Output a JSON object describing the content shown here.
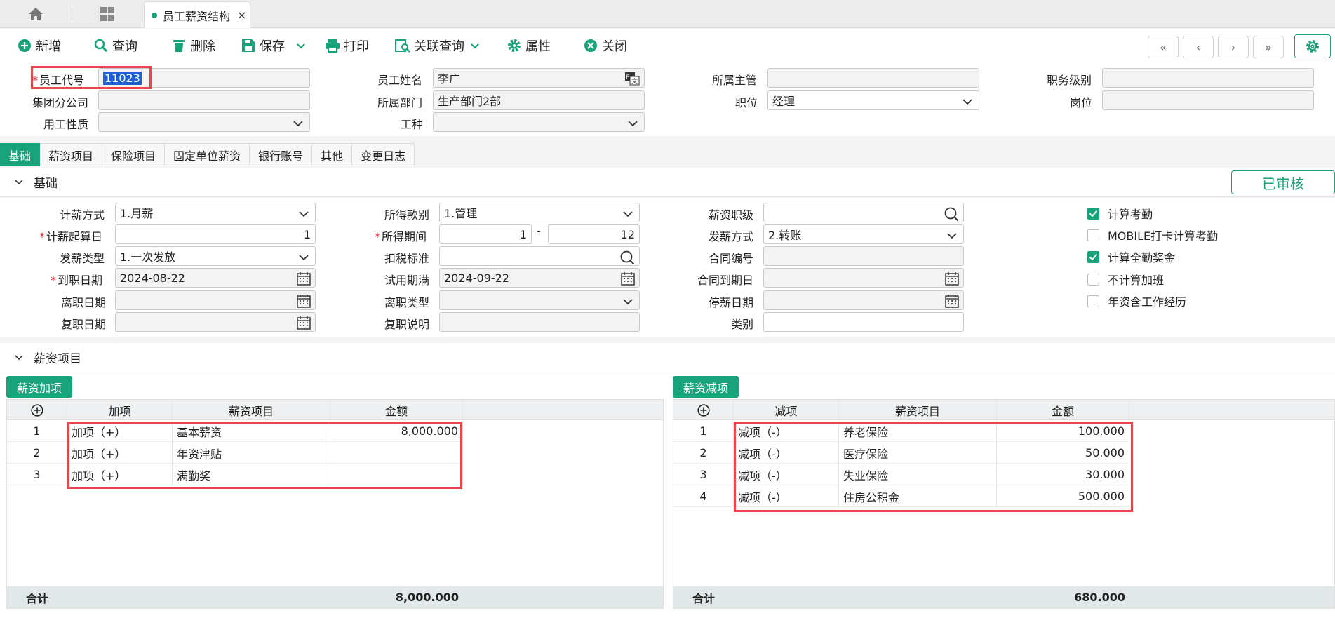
{
  "tabbar": {
    "active_tab": "员工薪资结构",
    "close_glyph": "×"
  },
  "toolbar": {
    "new": "新增",
    "query": "查询",
    "delete": "删除",
    "save": "保存",
    "print": "打印",
    "linked_query": "关联查询",
    "properties": "属性",
    "close": "关闭"
  },
  "header": {
    "employee_code_label": "员工代号",
    "employee_code": "11023",
    "employee_name_label": "员工姓名",
    "employee_name": "李广",
    "supervisor_label": "所属主管",
    "supervisor": "",
    "job_level_label": "职务级别",
    "job_level": "",
    "branch_label": "集团分公司",
    "branch": "",
    "department_label": "所属部门",
    "department": "生产部门2部",
    "position_label": "职位",
    "position": "经理",
    "post_label": "岗位",
    "post": "",
    "employment_type_label": "用工性质",
    "employment_type": "",
    "work_type_label": "工种",
    "work_type": ""
  },
  "subtabs": [
    "基础",
    "薪资项目",
    "保险项目",
    "固定单位薪资",
    "银行账号",
    "其他",
    "变更日志"
  ],
  "basic": {
    "section_title": "基础",
    "status": "已审核",
    "pay_method_label": "计薪方式",
    "pay_method": "1.月薪",
    "pay_start_day_label": "计薪起算日",
    "pay_start_day": "1",
    "payout_type_label": "发薪类型",
    "payout_type": "1.一次发放",
    "hire_date_label": "到职日期",
    "hire_date": "2024-08-22",
    "leave_date_label": "离职日期",
    "leave_date": "",
    "rehire_date_label": "复职日期",
    "rehire_date": "",
    "income_category_label": "所得款别",
    "income_category": "1.管理",
    "income_period_label": "所得期间",
    "income_period_from": "1",
    "income_period_sep": "-",
    "income_period_to": "12",
    "tax_standard_label": "扣税标准",
    "tax_standard": "",
    "probation_end_label": "试用期满",
    "probation_end": "2024-09-22",
    "leave_type_label": "离职类型",
    "leave_type": "",
    "rehire_note_label": "复职说明",
    "rehire_note": "",
    "salary_grade_label": "薪资职级",
    "salary_grade": "",
    "payout_method_label": "发薪方式",
    "payout_method": "2.转账",
    "contract_no_label": "合同编号",
    "contract_no": "",
    "contract_end_label": "合同到期日",
    "contract_end": "",
    "pay_stop_date_label": "停薪日期",
    "pay_stop_date": "",
    "category_label": "类别",
    "category": "",
    "checkboxes": [
      {
        "label": "计算考勤",
        "checked": true
      },
      {
        "label": "MOBILE打卡计算考勤",
        "checked": false
      },
      {
        "label": "计算全勤奖金",
        "checked": true
      },
      {
        "label": "不计算加班",
        "checked": false
      },
      {
        "label": "年资含工作经历",
        "checked": false
      }
    ]
  },
  "salary": {
    "section_title": "薪资项目",
    "add_button": "薪资加项",
    "deduct_button": "薪资减项",
    "add_headers": [
      "加项",
      "薪资项目",
      "金额"
    ],
    "deduct_headers": [
      "减项",
      "薪资项目",
      "金额"
    ],
    "add_rows": [
      {
        "no": "1",
        "type": "加项（+）",
        "item": "基本薪资",
        "amount": "8,000.000"
      },
      {
        "no": "2",
        "type": "加项（+）",
        "item": "年资津贴",
        "amount": ""
      },
      {
        "no": "3",
        "type": "加项（+）",
        "item": "满勤奖",
        "amount": ""
      }
    ],
    "deduct_rows": [
      {
        "no": "1",
        "type": "减项（-）",
        "item": "养老保险",
        "amount": "100.000"
      },
      {
        "no": "2",
        "type": "减项（-）",
        "item": "医疗保险",
        "amount": "50.000"
      },
      {
        "no": "3",
        "type": "减项（-）",
        "item": "失业保险",
        "amount": "30.000"
      },
      {
        "no": "4",
        "type": "减项（-）",
        "item": "住房公积金",
        "amount": "500.000"
      }
    ],
    "total_label": "合计",
    "add_total": "8,000.000",
    "deduct_total": "680.000"
  }
}
